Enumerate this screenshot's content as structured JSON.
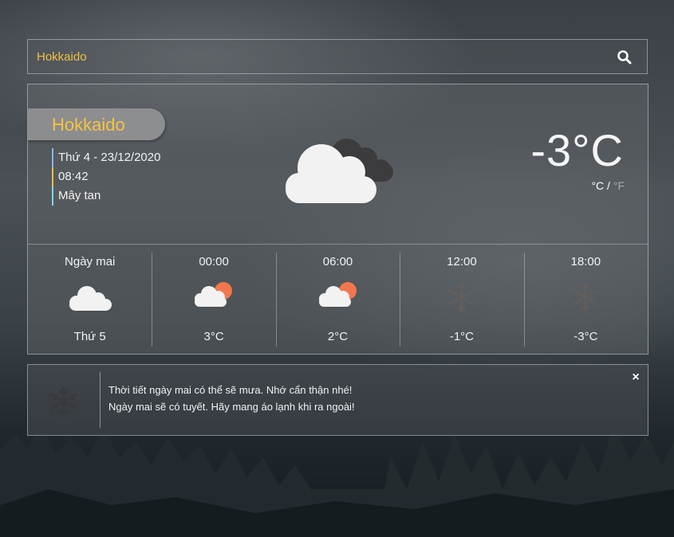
{
  "search": {
    "value": "Hokkaido",
    "icon": "search-icon"
  },
  "current": {
    "city": "Hokkaido",
    "date": "Thứ 4 - 23/12/2020",
    "time": "08:42",
    "description": "Mây tan",
    "icon": "clouds-icon",
    "temperature": "-3°C",
    "unit_c": "°C",
    "unit_sep": " / ",
    "unit_f": "°F"
  },
  "forecast": [
    {
      "label": "Ngày mai",
      "icon": "cloud-icon",
      "value": "Thứ 5"
    },
    {
      "label": "00:00",
      "icon": "sun-cloud-rain-icon",
      "value": "3°C"
    },
    {
      "label": "06:00",
      "icon": "sun-cloud-rain-icon",
      "value": "2°C"
    },
    {
      "label": "12:00",
      "icon": "snowflake-icon",
      "value": "-1°C"
    },
    {
      "label": "18:00",
      "icon": "snowflake-icon",
      "value": "-3°C"
    }
  ],
  "alert": {
    "icon": "snowflake-icon",
    "messages": [
      "Thời tiết ngày mai có thể sẽ mưa. Nhớ cẩn thận nhé!",
      "Ngày mai sẽ có tuyết. Hãy mang áo lạnh khi ra ngoài!"
    ],
    "close": "×"
  },
  "colors": {
    "accent": "#f4c542",
    "sun": "#f2774e",
    "cloud": "#f2f2f2",
    "dark_cloud": "#3c3c3e"
  }
}
